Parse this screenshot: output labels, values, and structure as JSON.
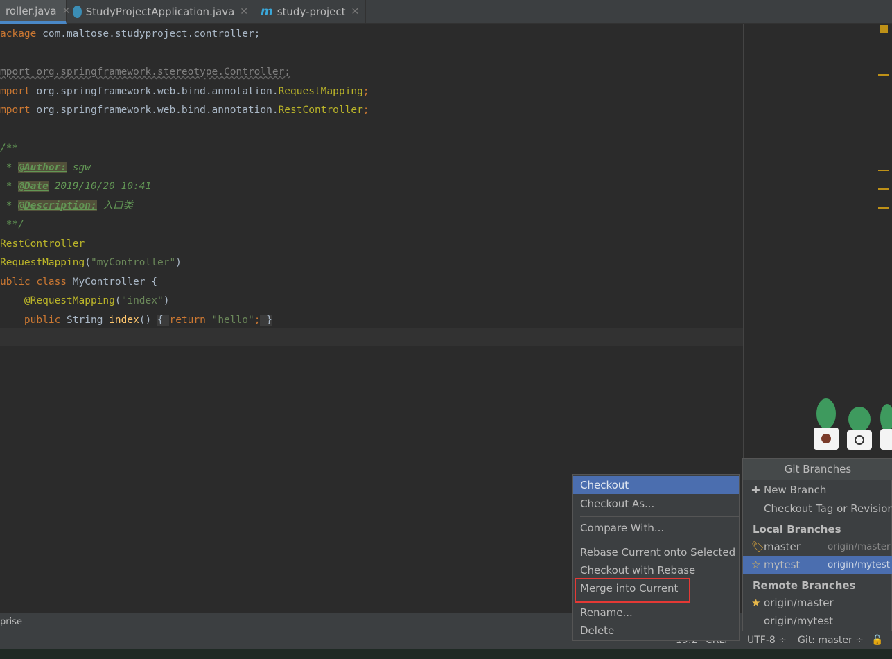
{
  "tabs": [
    {
      "label": "roller.java",
      "active": true
    },
    {
      "label": "StudyProjectApplication.java"
    },
    {
      "label": "study-project"
    }
  ],
  "code": {
    "l1a": "ackage",
    "l1b": " com.maltose.studyproject.controller;",
    "l3": "mport org.springframework.stereotype.Controller;",
    "l4a": "mport",
    "l4b": " org.springframework.web.bind.annotation.",
    "l4c": "RequestMapping",
    "l4d": ";",
    "l5a": "mport",
    "l5b": " org.springframework.web.bind.annotation.",
    "l5c": "RestController",
    "l5d": ";",
    "l7": "/**",
    "l8a": " * ",
    "l8b": "@Author:",
    "l8c": " sgw",
    "l9a": " * ",
    "l9b": "@Date",
    "l9c": " 2019/10/20 10:41",
    "l10a": " * ",
    "l10b": "@Description:",
    "l10c": " 入口类",
    "l11": " **/",
    "l12": "RestController",
    "l13a": "RequestMapping",
    "l13b": "(",
    "l13c": "\"myController\"",
    "l13d": ")",
    "l14a": "ublic class",
    "l14b": " MyController {",
    "l15a": "    @RequestMapping",
    "l15b": "(",
    "l15c": "\"index\"",
    "l15d": ")",
    "l16a": "    public",
    "l16b": " String ",
    "l16c": "index",
    "l16d": "() ",
    "l16e": "{ ",
    "l16f": "return ",
    "l16g": "\"hello\"",
    "l16h": ";",
    "l16i": " }"
  },
  "toolbar": {
    "text": "prise"
  },
  "status": {
    "position": "19:2",
    "line_sep": "CRLF",
    "encoding": "UTF-8 ÷",
    "vcs": "Git: master ÷"
  },
  "context_menu": {
    "items": [
      "Checkout",
      "Checkout As...",
      "Compare With...",
      "Rebase Current onto Selected",
      "Checkout with Rebase",
      "Merge into Current",
      "Rename...",
      "Delete"
    ],
    "selected": "Checkout",
    "highlighted": "Merge into Current"
  },
  "git_branches": {
    "title": "Git Branches",
    "actions": [
      "New Branch",
      "Checkout Tag or Revision..."
    ],
    "local_header": "Local Branches",
    "local": [
      {
        "name": "master",
        "remote": "origin/master",
        "icon": "tag-icon"
      },
      {
        "name": "mytest",
        "remote": "origin/mytest",
        "icon": "star-outline-icon",
        "selected": true
      }
    ],
    "remote_header": "Remote Branches",
    "remote": [
      {
        "name": "origin/master",
        "icon": "star-icon"
      },
      {
        "name": "origin/mytest"
      }
    ]
  },
  "colors": {
    "accent": "#4b6eaf",
    "highlight_box": "#e53935"
  }
}
